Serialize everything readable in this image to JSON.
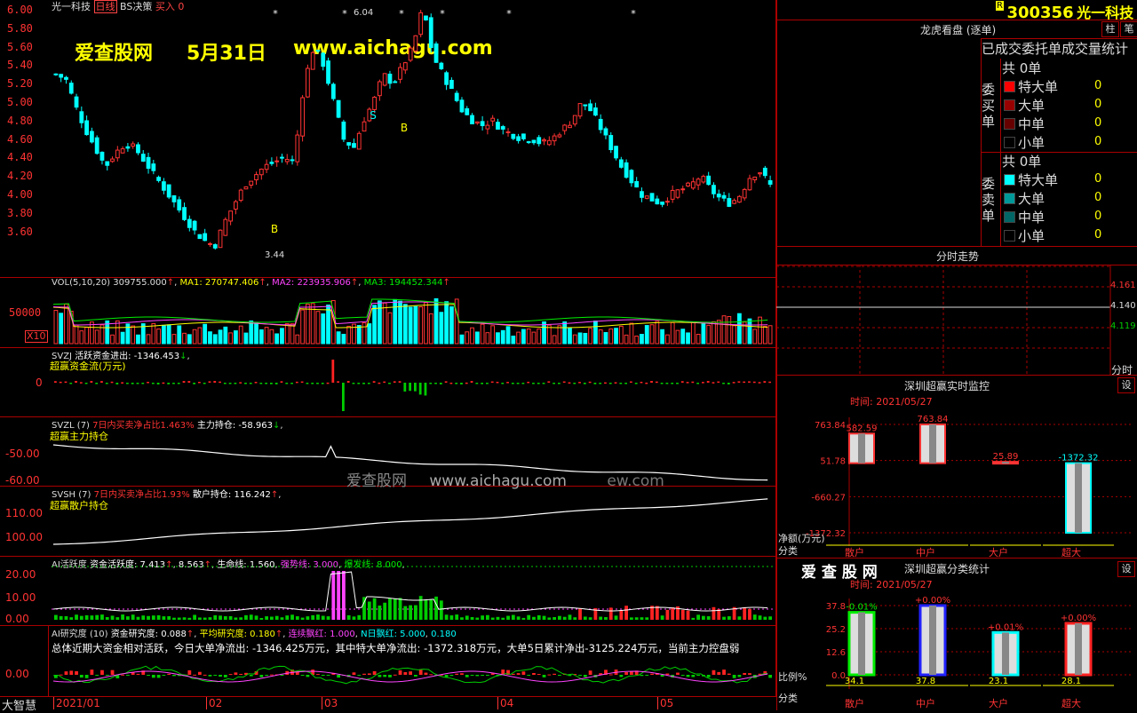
{
  "top_bar": {
    "stock_title": "光一科技",
    "period_label": "日线",
    "strategy": "BS决策",
    "signal": "买入",
    "signal_value": "0"
  },
  "watermark": {
    "brand": "爱查股网",
    "date": "5月31日",
    "url": "www.aichagu.com",
    "mid_watermark": "爱查股网",
    "mid_url": "www.aichagu.com",
    "mid_tail": "ew.com"
  },
  "price_axis": [
    "6.00",
    "5.80",
    "5.60",
    "5.40",
    "5.20",
    "5.00",
    "4.80",
    "4.60",
    "4.40",
    "4.20",
    "4.00",
    "3.80",
    "3.60"
  ],
  "price_marks": {
    "high": "6.04",
    "low": "3.44",
    "buy_label": "B",
    "sell_label": "S"
  },
  "vol_panel": {
    "title": "VOL(5,10,20)",
    "vol": "309755.000",
    "ma1": "MA1: 270747.406",
    "ma2": "MA2: 223935.906",
    "ma3": "MA3: 194452.344",
    "axis_value": "50000",
    "multiplier": "X10"
  },
  "svzj_panel": {
    "name": "SVZJ",
    "desc": "活跃资金进出: -1346.453",
    "sub": "超赢资金流(万元)",
    "axis_value": "0"
  },
  "svzl_panel": {
    "name": "SVZL (7)",
    "ratio": "7日内买卖净占比1.463%",
    "hold": "主力持仓: -58.963",
    "sub": "超赢主力持仓",
    "axis": [
      "-50.00",
      "-60.00"
    ]
  },
  "svsh_panel": {
    "name": "SVSH (7)",
    "ratio": "7日内买卖净占比1.93%",
    "hold": "散户持仓: 116.242",
    "sub": "超赢散户持仓",
    "axis": [
      "110.00",
      "100.00"
    ]
  },
  "ai_active_panel": {
    "name": "AI活跃度",
    "fund": "资金活跃度: 7.413",
    "v2": "8.563",
    "life": "生命线: 1.560",
    "strong": "强势线: 3.000",
    "burst": "爆发线: 8.000",
    "axis": [
      "20.00",
      "10.00",
      "0.00"
    ]
  },
  "ai_research_panel": {
    "name": "AI研究度 (10)",
    "research": "资金研究度: 0.088",
    "avg": "平均研究度: 0.180",
    "up": "连续飘红: 1.000",
    "nred": "N日飘红: 5.000",
    "last": "0.180",
    "summary": "总体近期大资金相对活跃，今日大单净流出: -1346.425万元，其中特大单净流出: -1372.318万元，大单5日累计净出-3125.224万元，当前主力控盘弱",
    "axis": "0.00"
  },
  "bottom_axis": {
    "corner": "大智慧",
    "months": [
      "2021/01",
      "02",
      "03",
      "04",
      "05"
    ]
  },
  "right_panel": {
    "code": "300356",
    "name": "光一科技",
    "r_badge": "R",
    "btn1": "柱",
    "btn2": "笔",
    "lhb_title": "龙虎看盘 (逐单)",
    "stats_title": "已成交委托单成交量统计",
    "buy_side": {
      "label": "委买单",
      "total": "共 0单",
      "rows": [
        {
          "name": "特大单",
          "value": "0",
          "color": "#ff0000"
        },
        {
          "name": "大单",
          "value": "0",
          "color": "#990000"
        },
        {
          "name": "中单",
          "value": "0",
          "color": "#660000"
        },
        {
          "name": "小单",
          "value": "0",
          "color": "#000000"
        }
      ]
    },
    "sell_side": {
      "label": "委卖单",
      "total": "共 0单",
      "rows": [
        {
          "name": "特大单",
          "value": "0",
          "color": "#00ffff"
        },
        {
          "name": "大单",
          "value": "0",
          "color": "#009999"
        },
        {
          "name": "中单",
          "value": "0",
          "color": "#006666"
        },
        {
          "name": "小单",
          "value": "0",
          "color": "#000000"
        }
      ]
    },
    "intraday": {
      "title": "分时走势",
      "prices": [
        "4.161",
        "4.140",
        "4.119"
      ],
      "unit": "分时"
    },
    "realtime": {
      "title": "深圳超赢实时监控",
      "set_btn": "设",
      "time": "时间: 2021/05/27",
      "axis": [
        "763.84",
        "51.78",
        "-660.27",
        "-1372.32"
      ],
      "unit": "净额(万元)",
      "cat_label": "分类",
      "bars": [
        {
          "name": "散户",
          "value": 582.59,
          "label": "582.59"
        },
        {
          "name": "中户",
          "value": 763.84,
          "label": "763.84"
        },
        {
          "name": "大户",
          "value": 25.89,
          "label": "25.89"
        },
        {
          "name": "超大",
          "value": -1372.32,
          "label": "-1372.32"
        }
      ]
    },
    "category": {
      "brand": "爱 查 股 网",
      "title": "深圳超赢分类统计",
      "set_btn": "设",
      "time": "时间: 2021/05/27",
      "axis": [
        "37.8",
        "25.2",
        "12.6",
        "0.0"
      ],
      "ratio_label": "比例%",
      "cat_label": "分类",
      "bars": [
        {
          "name": "散户",
          "value": 34.1,
          "change": "-0.01%",
          "color": "#00ee00"
        },
        {
          "name": "中户",
          "value": 37.8,
          "change": "+0.00%",
          "color": "#2222ff"
        },
        {
          "name": "大户",
          "value": 23.1,
          "change": "+0.01%",
          "color": "#00ffff"
        },
        {
          "name": "超大",
          "value": 28.1,
          "change": "+0.00%",
          "color": "#ff2222"
        }
      ]
    }
  }
}
